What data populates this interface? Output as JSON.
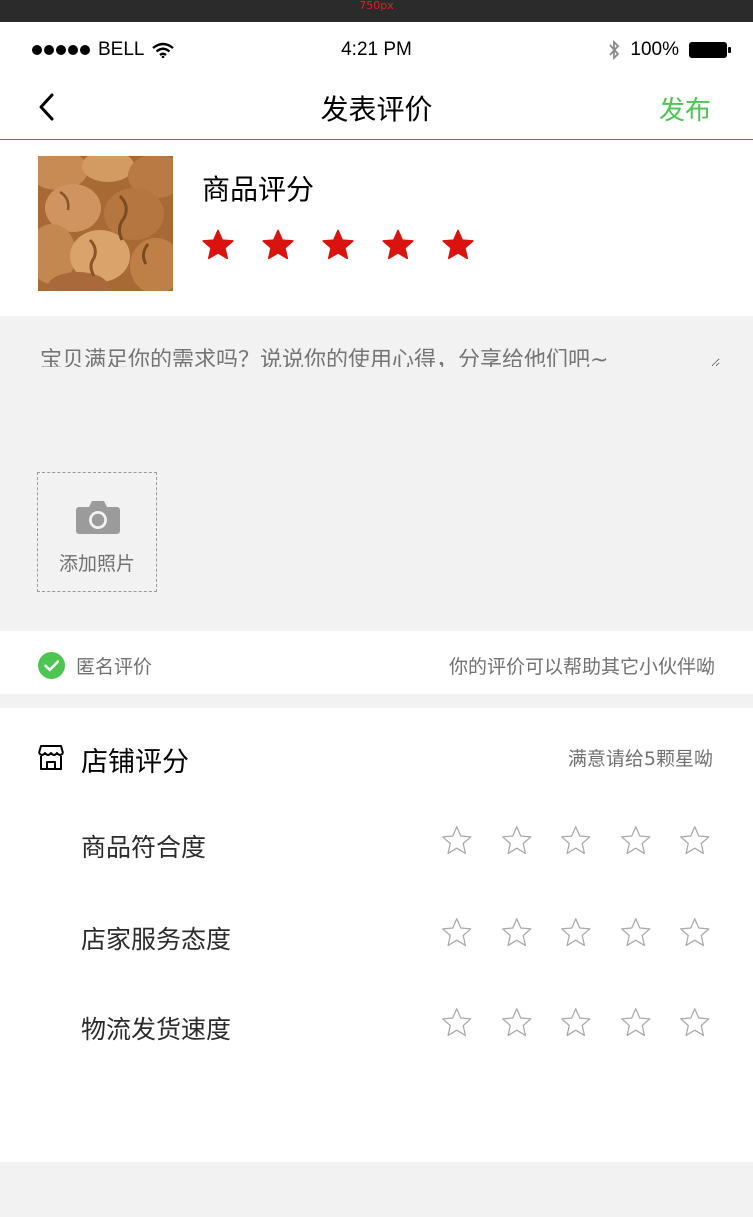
{
  "top_bar": {
    "label": "750px"
  },
  "status_bar": {
    "carrier": "BELL",
    "time": "4:21 PM",
    "battery": "100%"
  },
  "nav": {
    "title": "发表评价",
    "action": "发布"
  },
  "product": {
    "rating_label": "商品评分",
    "rating": 5,
    "max_rating": 5,
    "star_color": "#d9140e"
  },
  "review": {
    "placeholder": "宝贝满足你的需求吗？说说你的使用心得，分享给他们吧~",
    "add_photo_label": "添加照片",
    "background": "#f2f2f2"
  },
  "anonymous": {
    "label": "匿名评价",
    "checked": true,
    "hint": "你的评价可以帮助其它小伙伴呦",
    "check_color": "#4cc552"
  },
  "store": {
    "title": "店铺评分",
    "hint": "满意请给5颗星呦",
    "criteria": [
      {
        "label": "商品符合度",
        "rating": 0
      },
      {
        "label": "店家服务态度",
        "rating": 0
      },
      {
        "label": "物流发货速度",
        "rating": 0
      }
    ]
  },
  "icons": {
    "back": "chevron-left-icon",
    "wifi": "wifi-icon",
    "bluetooth": "bluetooth-icon",
    "battery": "battery-icon",
    "camera": "camera-icon",
    "check": "check-circle-icon",
    "store": "store-icon",
    "star_filled": "star-filled-icon",
    "star_outline": "star-outline-icon"
  },
  "colors": {
    "accent_green": "#4cc552",
    "star_red": "#d9140e",
    "text_primary": "#000000",
    "text_secondary": "#717171",
    "text_dark": "#2b2b2b"
  }
}
